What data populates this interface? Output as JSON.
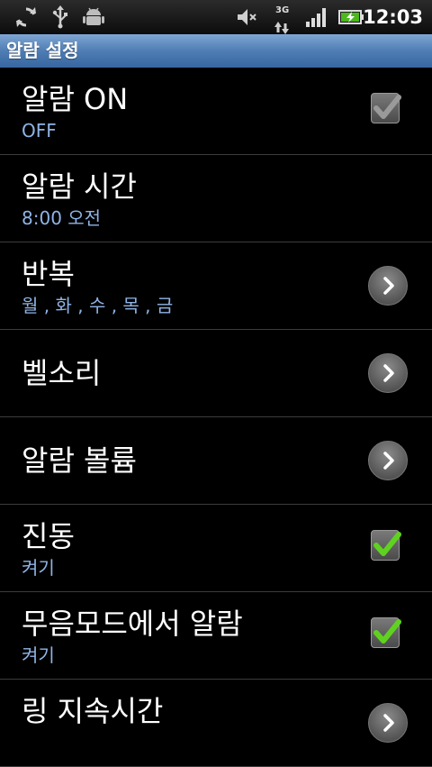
{
  "status_bar": {
    "time": "12:03",
    "network": "3G",
    "icons": [
      "sync-icon",
      "usb-icon",
      "android-debug-icon",
      "mute-icon",
      "data-3g-icon",
      "signal-icon",
      "battery-charging-icon"
    ]
  },
  "title_bar": {
    "title": "알람 설정"
  },
  "settings": [
    {
      "title": "알람 ON",
      "summary": "OFF",
      "control": "checkbox",
      "checked": false
    },
    {
      "title": "알람 시간",
      "summary": "8:00 오전",
      "control": "none"
    },
    {
      "title": "반복",
      "summary": "월 , 화 , 수 , 목 , 금",
      "control": "chevron"
    },
    {
      "title": "벨소리",
      "control": "chevron"
    },
    {
      "title": "알람 볼륨",
      "control": "chevron"
    },
    {
      "title": "진동",
      "summary": "켜기",
      "control": "checkbox",
      "checked": true
    },
    {
      "title": "무음모드에서 알람",
      "summary": "켜기",
      "control": "checkbox",
      "checked": true
    },
    {
      "title": "링 지속시간",
      "control": "chevron"
    }
  ],
  "colors": {
    "title_bar": "#4f7db4",
    "summary_text": "#8fb4e6",
    "check_green": "#5fd21f"
  }
}
